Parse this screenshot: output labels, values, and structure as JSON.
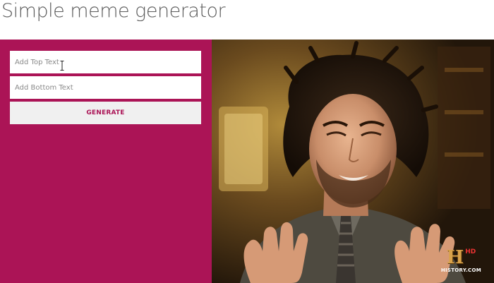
{
  "page": {
    "title": "Simple meme generator"
  },
  "form": {
    "top_text": {
      "placeholder": "Add Top Text",
      "value": ""
    },
    "bottom_text": {
      "placeholder": "Add Bottom Text",
      "value": ""
    },
    "generate_label": "GENERATE"
  },
  "meme": {
    "image_subject": "ancient-aliens-guy",
    "watermark": {
      "logo": "H",
      "badge": "HD",
      "site": "HISTORY.COM"
    }
  },
  "colors": {
    "panel": "#ab1456",
    "accent_text": "#ab1456",
    "button_bg": "#f0f0f0",
    "title_text": "#5b5b5b"
  }
}
